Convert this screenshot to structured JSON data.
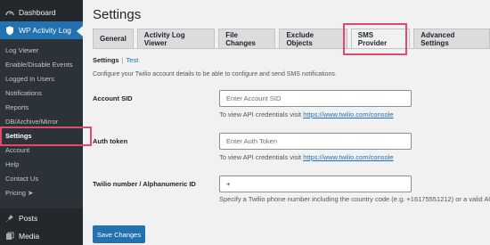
{
  "sidebar": {
    "dashboard": "Dashboard",
    "plugin": "WP Activity Log",
    "submenu": [
      "Log Viewer",
      "Enable/Disable Events",
      "Logged In Users",
      "Notifications",
      "Reports",
      "DB/Archive/Mirror",
      "Settings",
      "Account",
      "Help",
      "Contact Us",
      "Pricing ➤"
    ],
    "posts": "Posts",
    "media": "Media"
  },
  "page": {
    "title": "Settings"
  },
  "tabs": [
    "General",
    "Activity Log Viewer",
    "File Changes",
    "Exclude Objects",
    "SMS Provider",
    "Advanced Settings"
  ],
  "subnav": {
    "current": "Settings",
    "separator": "|",
    "other": "Test"
  },
  "intro": "Configure your Twilio account details to be able to configure and send SMS notifications.",
  "fields": {
    "account_sid": {
      "label": "Account SID",
      "placeholder": "Enter Account SID",
      "help_prefix": "To view API credentials visit",
      "help_link": "https://www.twilio.com/console"
    },
    "auth_token": {
      "label": "Auth token",
      "placeholder": "Enter Auth Token",
      "help_prefix": "To view API credentials visit",
      "help_link": "https://www.twilio.com/console"
    },
    "twilio_number": {
      "label": "Twilio number / Alphanumeric ID",
      "value": "+",
      "help": "Specify a Twilio phone number including the country code (e.g. +16175551212) or a valid Alphanum"
    }
  },
  "save_button": "Save Changes",
  "colors": {
    "sidebar_bg": "#23282d",
    "accent": "#2271b1",
    "highlight": "#e04a6f"
  }
}
